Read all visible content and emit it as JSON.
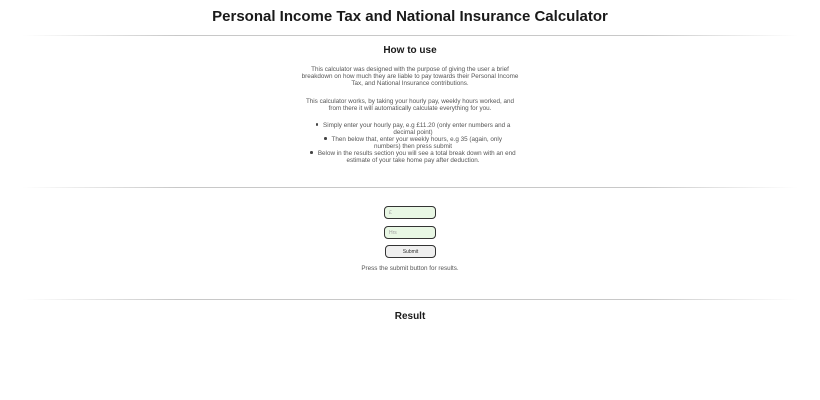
{
  "header": {
    "title": "Personal Income Tax and National Insurance Calculator"
  },
  "how_to_use": {
    "heading": "How to use",
    "paragraph_1": "This calculator was designed with the purpose of giving the user a brief breakdown on how much they are liable to pay towards their Personal Income Tax, and National Insurance contributions.",
    "paragraph_2": "This calculator works, by taking your hourly pay, weekly hours worked, and from there it will automatically calculate everything for you.",
    "steps": [
      "Simply enter your hourly pay, e.g £11.20 (only enter numbers and a decimal point)",
      "Then below that, enter your weekly hours, e.g 35 (again, only numbers) then press submit",
      "Below in the results section you will see a total break down with an end estimate of your take home pay after deduction."
    ]
  },
  "form": {
    "pay_placeholder": "£",
    "hours_placeholder": "Hrs",
    "submit_label": "Submit",
    "hint": "Press the submit button for results."
  },
  "result": {
    "heading": "Result"
  }
}
